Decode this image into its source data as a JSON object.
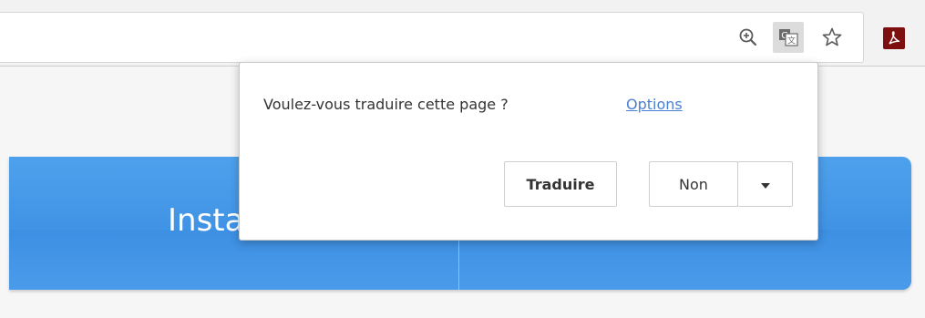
{
  "toolbar": {
    "icons": [
      "zoom-icon",
      "translate-icon",
      "star-icon",
      "pdf-icon"
    ]
  },
  "page": {
    "banner_text": "Insta"
  },
  "translate_bubble": {
    "question": "Voulez-vous traduire cette page ?",
    "options_link": "Options",
    "translate_button": "Traduire",
    "decline_button": "Non"
  },
  "colors": {
    "banner_blue": "#4a9bea",
    "link_blue": "#4a7fd3",
    "pdf_red": "#7e0f0f",
    "toolbar_bg": "#f2f2f2"
  }
}
